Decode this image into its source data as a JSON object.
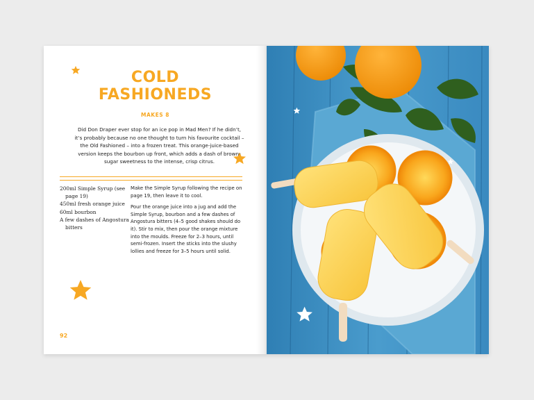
{
  "left_page": {
    "title_line1": "COLD",
    "title_line2": "FASHIONEDS",
    "makes": "MAKES 8",
    "intro": "Did Don Draper ever stop for an ice pop in Mad Men? If he didn’t, it’s probably because no one thought to turn his favourite cocktail – the Old Fashioned – into a frozen treat. This orange-juice-based version keeps the bourbon up front, which adds a dash of brown-sugar sweetness to the intense, crisp citrus.",
    "ingredients": [
      "200ml Simple Syrup (see page 19)",
      "450ml fresh orange juice",
      "60ml bourbon",
      "A few dashes of Angostura bitters"
    ],
    "method": [
      "Make the Simple Syrup following the recipe on page 19, then leave it to cool.",
      "Pour the orange juice into a jug and add the Simple Syrup, bourbon and a few dashes of Angostura bitters (4–5 good shakes should do it). Stir to mix, then pour the orange mixture into the moulds. Freeze for 2–3 hours, until semi-frozen. Insert the sticks into the slushy lollies and freeze for 3–5 hours until solid."
    ],
    "page_number": "92"
  },
  "colors": {
    "accent": "#f7a823",
    "text": "#222222",
    "table_blue": "#3f93c4",
    "napkin_blue": "#5aa8d3",
    "orange": "#f79a12",
    "popsicle_yellow": "#fcd760",
    "leaf_green": "#2f5f1e"
  },
  "icons": [
    "star-icon"
  ]
}
